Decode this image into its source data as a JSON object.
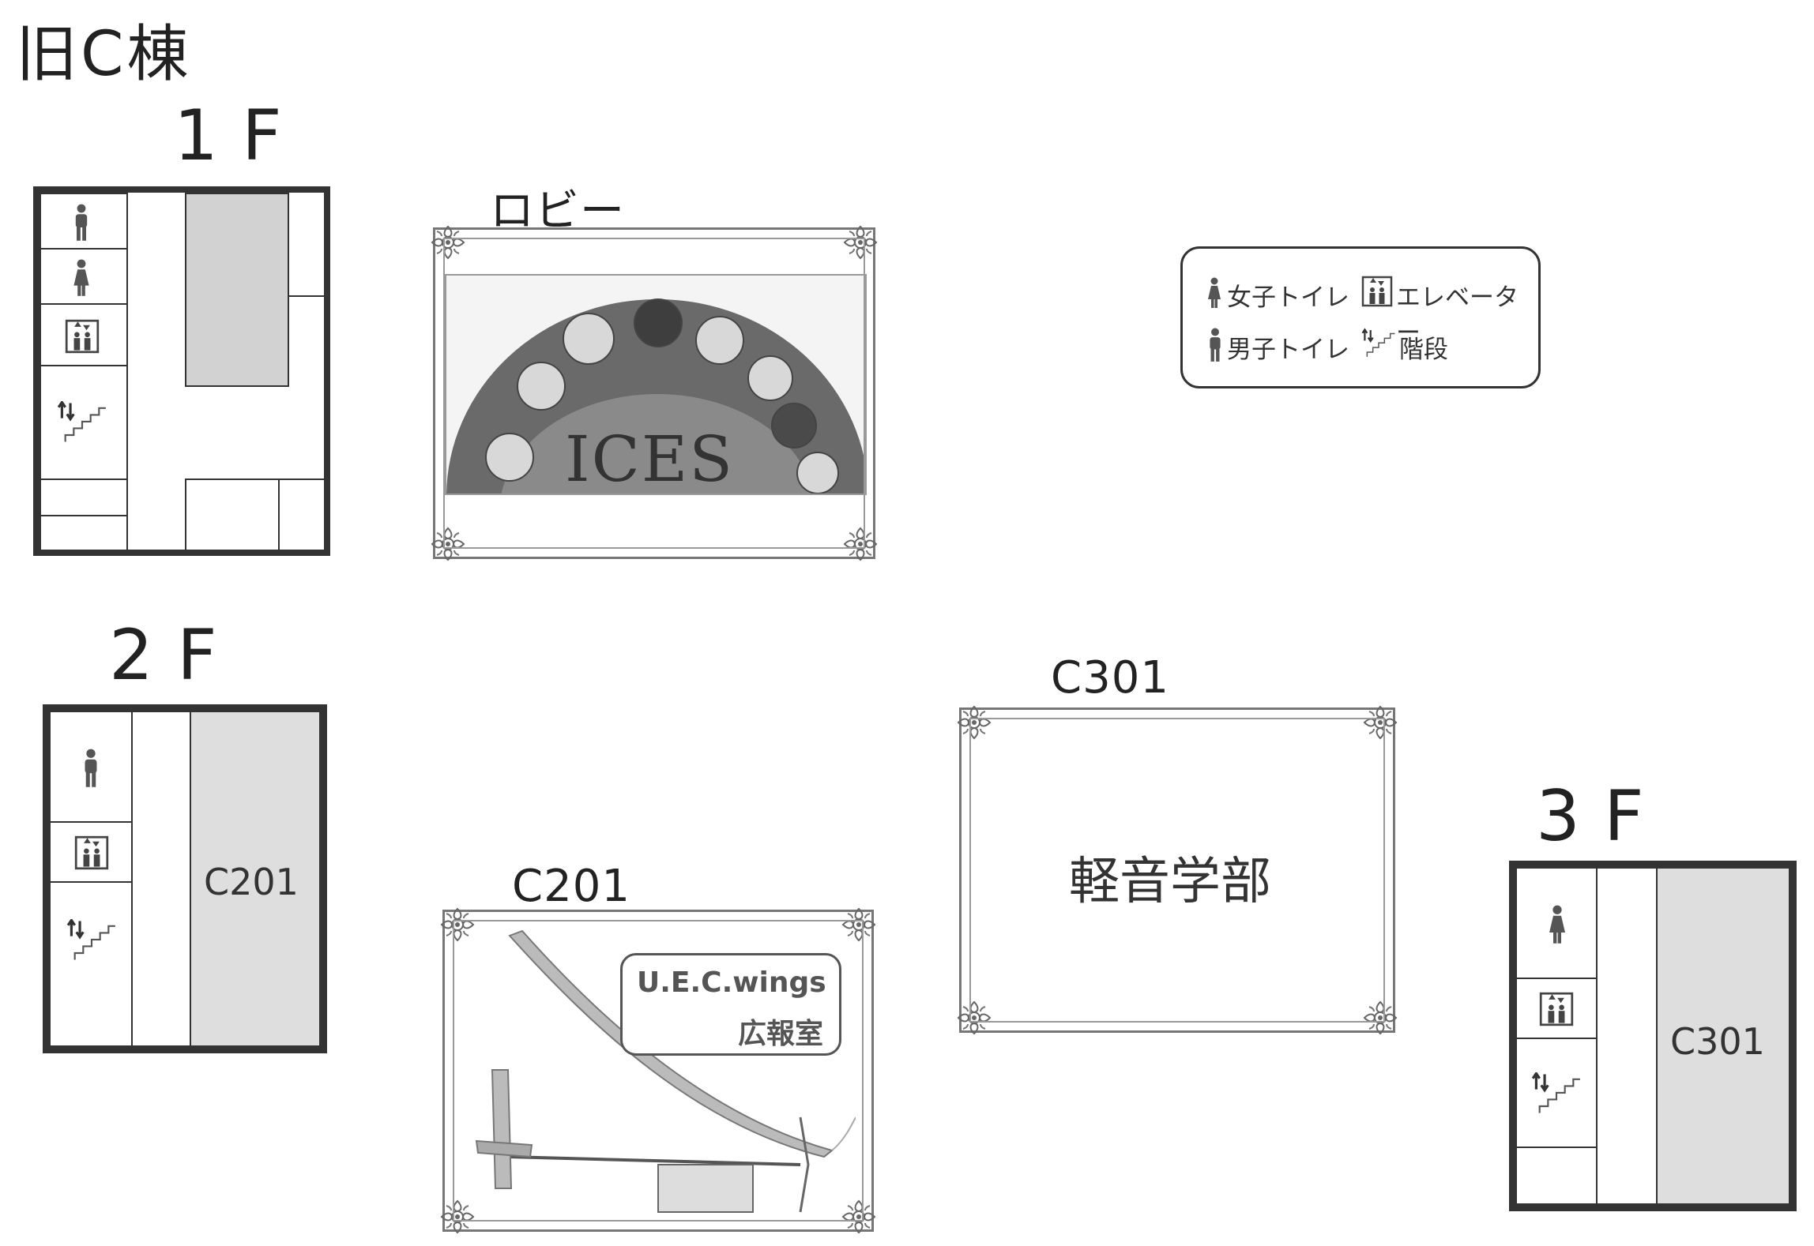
{
  "title": "旧C棟",
  "floors": {
    "f1": {
      "label": "1F"
    },
    "f2": {
      "label": "2F",
      "room": "C201"
    },
    "f3": {
      "label": "3F",
      "room": "C301"
    }
  },
  "rooms": {
    "lobby": {
      "label": "ロビー",
      "banner_text": "ICES"
    },
    "c201": {
      "label": "C201",
      "org_name": "U.E.C.wings",
      "org_room": "広報室"
    },
    "c301": {
      "label": "C301",
      "content": "軽音学部"
    }
  },
  "legend": {
    "womens_toilet": "女子トイレ",
    "elevator": "エレベーター",
    "mens_toilet": "男子トイレ",
    "stairs": "階段"
  },
  "colors": {
    "line": "#333333",
    "shaded_room": "#d2d2d2",
    "banner_bg": "#6a6a6a"
  }
}
